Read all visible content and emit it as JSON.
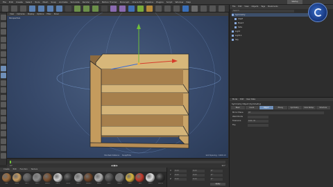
{
  "app": {
    "name": "CINEMA 4D",
    "layout_label": "Startup"
  },
  "menubar": [
    "File",
    "Edit",
    "Create",
    "Select",
    "Tools",
    "Mesh",
    "Snap",
    "Animate",
    "Simulate",
    "Render",
    "Sculpt",
    "Motion Tracker",
    "MoGraph",
    "Character",
    "Pipeline",
    "Plugins",
    "Script",
    "Window",
    "Help"
  ],
  "viewport": {
    "menu": [
      "View",
      "Cameras",
      "Display",
      "Options",
      "Filter",
      "Panel"
    ],
    "label": "Perspective",
    "footer_left": "Shortest distance",
    "footer_right": "Snap/Hide",
    "grid_label": "Grid Spacing : 1000 cm",
    "bg_color": "#3a4d6a"
  },
  "object_manager": {
    "menu": [
      "File",
      "Edit",
      "View",
      "Objects",
      "Tags",
      "Bookmarks"
    ],
    "search": "Search",
    "objects": [
      "Symmetry",
      "Shelf",
      "Board",
      "Side",
      "Light",
      "Light.1",
      "Sky"
    ]
  },
  "attributes": {
    "menu": [
      "Mode",
      "Edit",
      "User Data"
    ],
    "title": "Symmetry Object [Symmetry]",
    "tabs": [
      "Basic",
      "Coord.",
      "Object",
      "Phong",
      "Symmetry",
      "Color Rollup",
      "Structure"
    ],
    "active_tab": "Object",
    "rows": [
      {
        "label": "Mirror Plane",
        "value": "XY"
      },
      {
        "label": "Weld Points",
        "value": ""
      },
      {
        "label": "Tolerance",
        "value": "0.01 cm"
      },
      {
        "label": "Flip",
        "value": ""
      }
    ]
  },
  "timeline": {
    "start": "0 F",
    "end": "90 F",
    "current": "0 F"
  },
  "material_manager": {
    "menu": [
      "Create",
      "Edit",
      "Function",
      "Texture"
    ],
    "materials": [
      {
        "name": "Mat",
        "color": "#9b6a3a"
      },
      {
        "name": "Wood",
        "color": "#c49a5e"
      },
      {
        "name": "Mat.1",
        "color": "#5a5a5a"
      },
      {
        "name": "Mat.2",
        "color": "#8a8a8a"
      },
      {
        "name": "Wood.1",
        "color": "#7a5030"
      },
      {
        "name": "Mat.3",
        "color": "#d0d0d0"
      },
      {
        "name": "Mat.4",
        "color": "#3a3a3a"
      },
      {
        "name": "Mat.5",
        "color": "#a3a3a3"
      },
      {
        "name": "Wood.2",
        "color": "#6b4226"
      },
      {
        "name": "Mat.6",
        "color": "#b0b0b0"
      },
      {
        "name": "Mat.7",
        "color": "#4d4d4d"
      },
      {
        "name": "Mat.8",
        "color": "#777777"
      },
      {
        "name": "Gold",
        "color": "#d6b23e"
      },
      {
        "name": "Red",
        "color": "#c0392b"
      },
      {
        "name": "Mat.9",
        "color": "#e0e0e0"
      },
      {
        "name": "Mat.10",
        "color": "#2e2e2e"
      }
    ]
  },
  "coordinates": {
    "rows": [
      {
        "axis": "X",
        "pos": "0 cm",
        "size": "0 cm",
        "rot": "0 °"
      },
      {
        "axis": "Y",
        "pos": "0 cm",
        "size": "0 cm",
        "rot": "0 °"
      },
      {
        "axis": "Z",
        "pos": "0 cm",
        "size": "0 cm",
        "rot": "0 °"
      }
    ],
    "apply_label": "Apply"
  },
  "colors": {
    "accent": "#6f8fb8",
    "wood": "#c9a468"
  }
}
